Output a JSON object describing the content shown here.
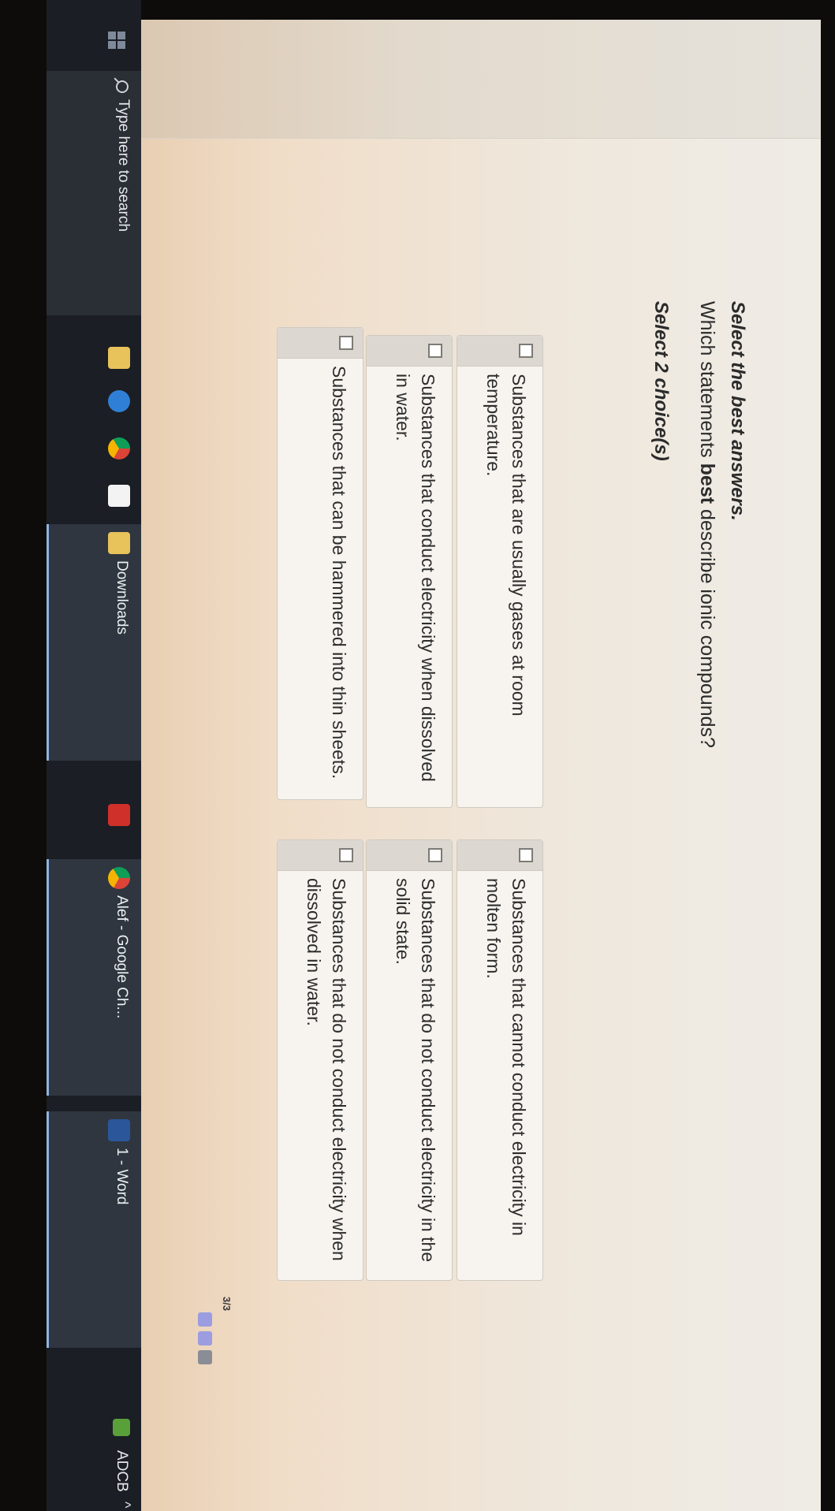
{
  "question": {
    "heading": "Select the best answers.",
    "text_before": "Which statements ",
    "text_bold": "best",
    "text_after": " describe ionic compounds?",
    "instruction": "Select 2 choice(s)"
  },
  "choices": [
    {
      "label": "Substances that can be hammered into thin sheets."
    },
    {
      "label": "Substances that do not conduct electricity when dissolved in water."
    },
    {
      "label": "Substances that conduct electricity when dissolved in water."
    },
    {
      "label": "Substances that do not conduct electricity in the solid state."
    },
    {
      "label": "Substances that are usually gases at room temperature."
    },
    {
      "label": "Substances that cannot conduct electricity in molten form."
    }
  ],
  "progress": {
    "text": "3/3"
  },
  "taskbar": {
    "search_placeholder": "Type here to search",
    "apps": [
      {
        "label": "Downloads"
      },
      {
        "label": "Alef - Google Ch..."
      },
      {
        "label": "1 - Word"
      }
    ],
    "tray_label": "ADCB"
  },
  "colors": {
    "progress_dot": "#9b9de0",
    "progress_dot_inactive": "#8a8c96",
    "taskbar": "#1b1e24"
  }
}
